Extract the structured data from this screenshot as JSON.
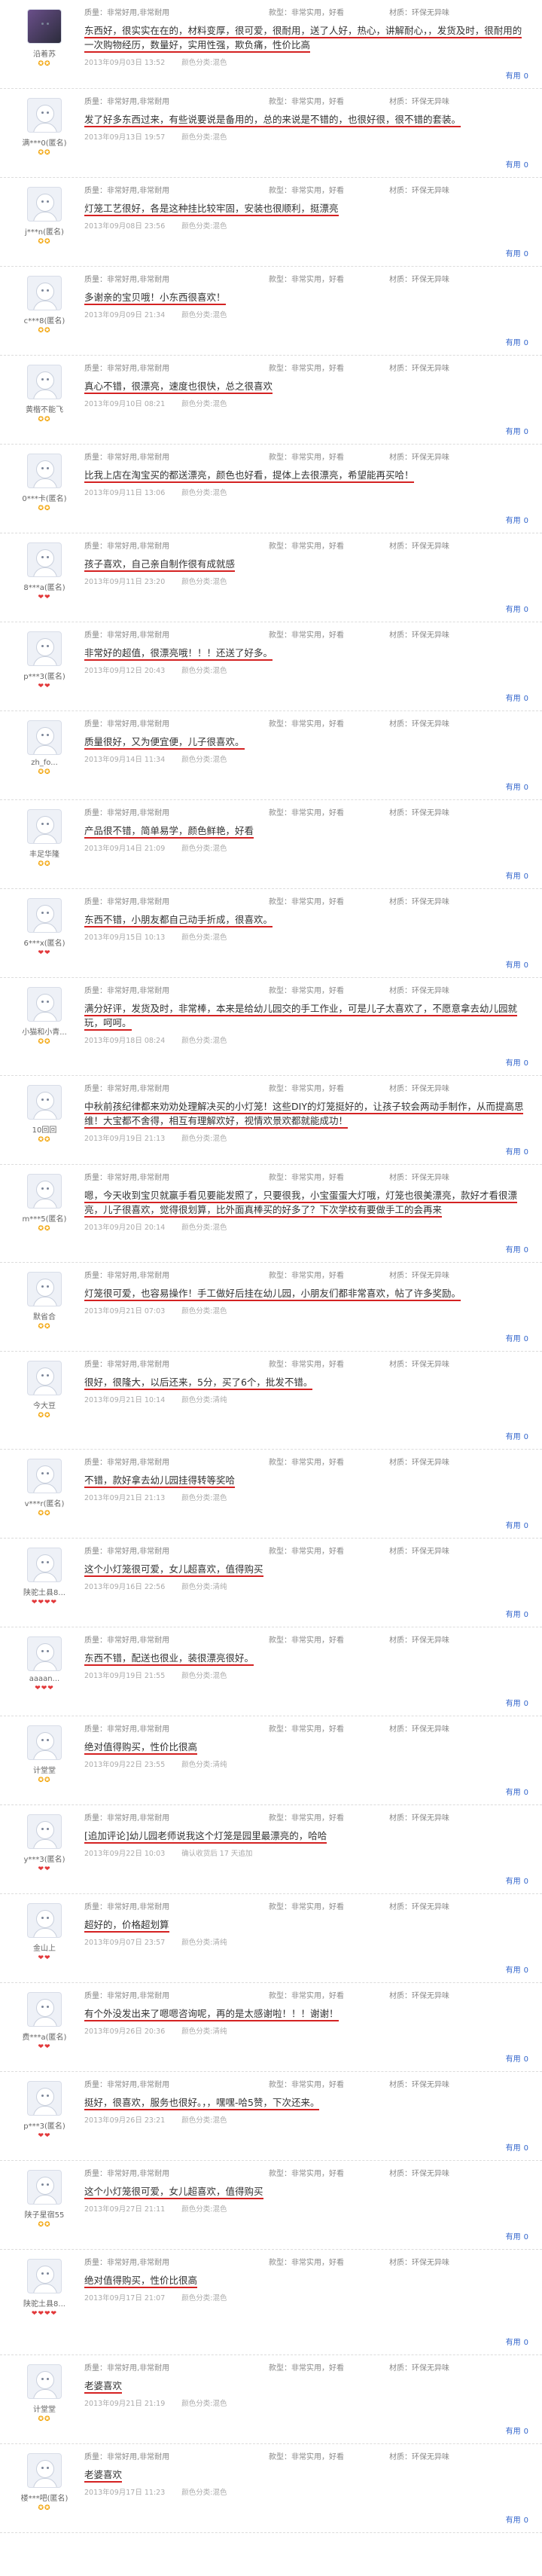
{
  "meta_labels": {
    "quality": "质量：非常好用,非常耐用",
    "material": "款型：非常实用，好看",
    "size": "材质：环保无异味"
  },
  "useful_label": "有用",
  "reviews": [
    {
      "user": "沿着苏",
      "badge": "✪✪",
      "text": "东西好，很实实在在的，材料变厚，很可爱，很耐用，送了人好，热心，讲解耐心，，发货及时，很耐用的一次购物经历，数量好，实用性强，欺负痛，性价比高",
      "time": "2013年09月03日 13:52",
      "color": "颜色分类:混色",
      "count": "0"
    },
    {
      "user": "满***0(匿名)",
      "badge": "✪✪",
      "text": "发了好多东西过来，有些说要说是备用的，总的来说是不错的，也很好很，很不错的套装。",
      "time": "2013年09月13日 19:57",
      "color": "颜色分类:混色",
      "count": "0"
    },
    {
      "user": "j***n(匿名)",
      "badge": "✪✪",
      "text": "灯笼工艺很好，各是这种挂比较牢固，安装也很顺利，挺漂亮",
      "time": "2013年09月08日 23:56",
      "color": "颜色分类:混色",
      "count": "0"
    },
    {
      "user": "c***8(匿名)",
      "badge": "✪✪",
      "text": "多谢亲的宝贝哦！小东西很喜欢！",
      "time": "2013年09月09日 21:34",
      "color": "颜色分类:混色",
      "count": "0"
    },
    {
      "user": "黄楷不能飞",
      "badge": "✪✪",
      "text": "真心不错，很漂亮，速度也很快，总之很喜欢",
      "time": "2013年09月10日 08:21",
      "color": "颜色分类:混色",
      "count": "0"
    },
    {
      "user": "0***卡(匿名)",
      "badge": "✪✪",
      "text": "比我上店在淘宝买的都送漂亮，颜色也好看，提体上去很漂亮，希望能再买哈！",
      "time": "2013年09月11日 13:06",
      "color": "颜色分类:混色",
      "count": "0"
    },
    {
      "user": "8***a(匿名)",
      "badge": "❤❤",
      "text": "孩子喜欢，自己亲自制作很有成就感",
      "time": "2013年09月11日 23:20",
      "color": "颜色分类:混色",
      "count": "0"
    },
    {
      "user": "p***3(匿名)",
      "badge": "❤❤",
      "text": "非常好的超值，很漂亮哦！！！还送了好多。",
      "time": "2013年09月12日 20:43",
      "color": "颜色分类:混色",
      "count": "0"
    },
    {
      "user": "zh_fo...",
      "badge": "✪✪",
      "text": "质量很好，又为便宜便，儿子很喜欢。",
      "time": "2013年09月14日 11:34",
      "color": "颜色分类:混色",
      "count": "0"
    },
    {
      "user": "丰足华隆",
      "badge": "✪✪",
      "text": "产品很不错，简单易学，颜色鲜艳，好看",
      "time": "2013年09月14日 21:09",
      "color": "颜色分类:混色",
      "count": "0"
    },
    {
      "user": "6***x(匿名)",
      "badge": "❤❤",
      "text": "东西不错，小朋友都自己动手折成，很喜欢。",
      "time": "2013年09月15日 10:13",
      "color": "颜色分类:混色",
      "count": "0"
    },
    {
      "user": "小猫和小青...",
      "badge": "✪✪",
      "text": "满分好评，发货及时，非常棒，本来是给幼儿园交的手工作业，可是儿子太喜欢了，不愿意拿去幼儿园就玩，呵呵。",
      "time": "2013年09月18日 08:24",
      "color": "颜色分类:混色",
      "count": "0"
    },
    {
      "user": "10回回",
      "badge": "✪✪",
      "text": "中秋前孩纪律都来劝劝处理解决买的小灯笼！这些DIY的灯笼挺好的，让孩子较会两动手制作，从而提高思维！大宝都不舍得，相互有理解欢好，视情欢景欢都就能成功！",
      "time": "2013年09月19日 21:13",
      "color": "颜色分类:混色",
      "count": "0"
    },
    {
      "user": "m***5(匿名)",
      "badge": "✪✪",
      "text": "嗯，今天收到宝贝就赢手看见要能发照了，只要很我，小宝蛋蛋大灯哦，灯笼也很美漂亮，款好才看很漂亮，儿子很喜欢，觉得很划算，比外面真棒买的好多了？下次学校有要做手工的会再来",
      "time": "2013年09月20日 20:14",
      "color": "颜色分类:混色",
      "count": "0"
    },
    {
      "user": "默省合",
      "badge": "✪✪",
      "text": "灯笼很可爱，也容易操作！手工做好后挂在幼儿园，小朋友们都非常喜欢，帖了许多奖励。",
      "time": "2013年09月21日 07:03",
      "color": "颜色分类:混色",
      "count": "0"
    },
    {
      "user": "今大豆",
      "badge": "✪✪",
      "text": "很好，很隆大，以后还来，5分，买了6个，批发不错。",
      "time": "2013年09月21日 10:14",
      "color": "颜色分类:清纯",
      "count": "0"
    },
    {
      "user": "v***r(匿名)",
      "badge": "✪✪",
      "text": "不错，款好拿去幼儿园挂得转等奖哈",
      "time": "2013年09月21日 21:13",
      "color": "颜色分类:混色",
      "count": "0"
    },
    {
      "user": "陕驼土县8...",
      "badge": "❤❤❤❤",
      "text": "这个小灯笼很可爱，女儿超喜欢，值得购买",
      "time": "2013年09月16日 22:56",
      "color": "颜色分类:清纯",
      "count": "0"
    },
    {
      "user": "aaaan...",
      "badge": "❤❤❤",
      "text": "东西不错，配送也很业，装很漂亮很好。",
      "time": "2013年09月19日 21:55",
      "color": "颜色分类:混色",
      "count": "0"
    },
    {
      "user": "计堂堂",
      "badge": "✪✪",
      "text": "绝对值得购买，性价比很高",
      "time": "2013年09月22日 23:55",
      "color": "颜色分类:清纯",
      "count": "0"
    },
    {
      "user": "y***3(匿名)",
      "badge": "❤❤",
      "text": "[追加评论]幼儿园老师说我这个灯笼是园里最漂亮的，哈哈",
      "time": "2013年09月22日 10:03",
      "color": "确认收货后 17 天追加",
      "count": "0"
    },
    {
      "user": "金山上",
      "badge": "❤❤",
      "text": "超好的，价格超划算",
      "time": "2013年09月07日 23:57",
      "color": "颜色分类:清纯",
      "count": "0"
    },
    {
      "user": "费***a(匿名)",
      "badge": "❤❤",
      "text": "有个外没发出来了嗯嗯咨询呢，再的是太感谢啦！！！谢谢！",
      "time": "2013年09月26日 20:36",
      "color": "颜色分类:清纯",
      "count": "0"
    },
    {
      "user": "p***3(匿名)",
      "badge": "❤❤",
      "text": "挺好，很喜欢，服务也很好。，，嘿嘿-哈5赞，下次还来。",
      "time": "2013年09月26日 23:21",
      "color": "颜色分类:混色",
      "count": "0"
    },
    {
      "user": "陕子星宿55",
      "badge": "✪✪",
      "text": "这个小灯笼很可爱，女儿超喜欢，值得购买",
      "time": "2013年09月27日 21:11",
      "color": "颜色分类:混色",
      "count": "0"
    },
    {
      "user": "陕驼土县8...",
      "badge": "❤❤❤❤",
      "text": "绝对值得购买，性价比很高",
      "time": "2013年09月17日 21:07",
      "color": "颜色分类:混色",
      "count": "0"
    },
    {
      "user": "计堂堂",
      "badge": "✪✪",
      "text": "老婆喜欢",
      "time": "2013年09月21日 21:19",
      "color": "颜色分类:混色",
      "count": "0"
    },
    {
      "user": "楼***吧(匿名)",
      "badge": "✪✪",
      "text": "老婆喜欢",
      "time": "2013年09月17日 11:23",
      "color": "颜色分类:混色",
      "count": "0"
    }
  ]
}
